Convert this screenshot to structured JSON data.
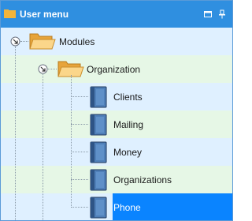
{
  "window": {
    "title": "User menu",
    "buttons": {
      "restore_icon": "window-restore-icon",
      "pin_icon": "pin-icon"
    }
  },
  "tree": {
    "modules": {
      "label": "Modules",
      "state": "expanded"
    },
    "organization": {
      "label": "Organization",
      "state": "expanded"
    },
    "items": [
      {
        "label": "Clients"
      },
      {
        "label": "Mailing"
      },
      {
        "label": "Money"
      },
      {
        "label": "Organizations"
      },
      {
        "label": "Phone",
        "selected": true
      }
    ]
  },
  "colors": {
    "titlebar": "#2f8fe0",
    "row_blue": "#dff0ff",
    "row_green": "#e6f7e6",
    "selection": "#0a84ff"
  }
}
